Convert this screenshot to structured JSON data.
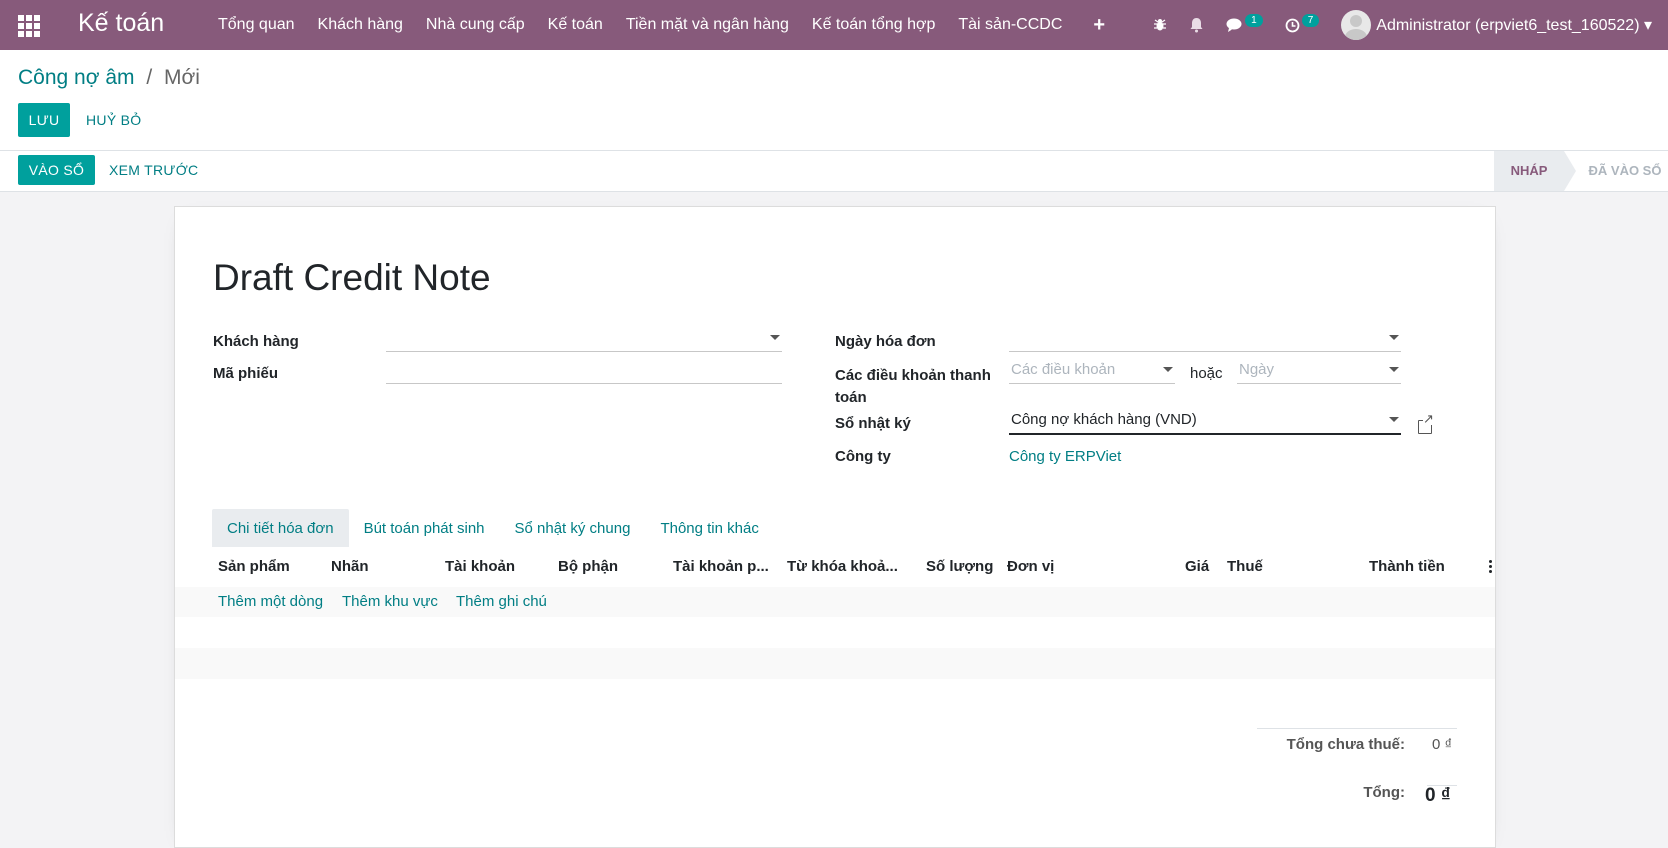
{
  "navbar": {
    "brand": "Kế toán",
    "menu": [
      "Tổng quan",
      "Khách hàng",
      "Nhà cung cấp",
      "Kế toán",
      "Tiền mặt và ngân hàng",
      "Kế toán tổng hợp",
      "Tài sản-CCDC"
    ],
    "plus": "+",
    "messages_badge": "1",
    "activities_badge": "7",
    "user": "Administrator (erpviet6_test_160522) ▾",
    "color": "#875a7b"
  },
  "breadcrumb": {
    "parent": "Công nợ âm",
    "separator": "/",
    "current": "Mới"
  },
  "actions": {
    "save": "LƯU",
    "discard": "HUỶ BỎ",
    "post": "VÀO SỔ",
    "preview": "XEM TRƯỚC"
  },
  "status": {
    "draft": "NHÁP",
    "posted": "ĐÃ VÀO SỔ"
  },
  "form": {
    "title": "Draft Credit Note",
    "customer_label": "Khách hàng",
    "customer_value": "",
    "ref_label": "Mã phiếu",
    "ref_value": "",
    "invoice_date_label": "Ngày hóa đơn",
    "invoice_date_value": "",
    "payment_terms_label": "Các điều khoản thanh toán",
    "payment_terms_placeholder": "Các điều khoản",
    "or": "hoặc",
    "due_date_placeholder": "Ngày",
    "journal_label": "Sổ nhật ký",
    "journal_value": "Công nợ khách hàng (VND)",
    "company_label": "Công ty",
    "company_value": "Công ty ERPViet"
  },
  "tabs": [
    "Chi tiết hóa đơn",
    "Bút toán phát sinh",
    "Sổ nhật ký chung",
    "Thông tin khác"
  ],
  "table": {
    "columns": [
      "Sản phẩm",
      "Nhãn",
      "Tài khoản",
      "Bộ phận",
      "Tài khoản p...",
      "Từ khóa khoả...",
      "Số lượng",
      "Đơn vị",
      "Giá",
      "Thuế",
      "Thành tiền"
    ],
    "add_line": "Thêm một dòng",
    "add_section": "Thêm khu vực",
    "add_note": "Thêm ghi chú"
  },
  "totals": {
    "untaxed_label": "Tổng chưa thuế:",
    "untaxed_value": "0 ₫",
    "total_label": "Tổng:",
    "total_value": "0 ₫"
  },
  "colors": {
    "accent": "#00a09d",
    "link": "#017e84"
  }
}
